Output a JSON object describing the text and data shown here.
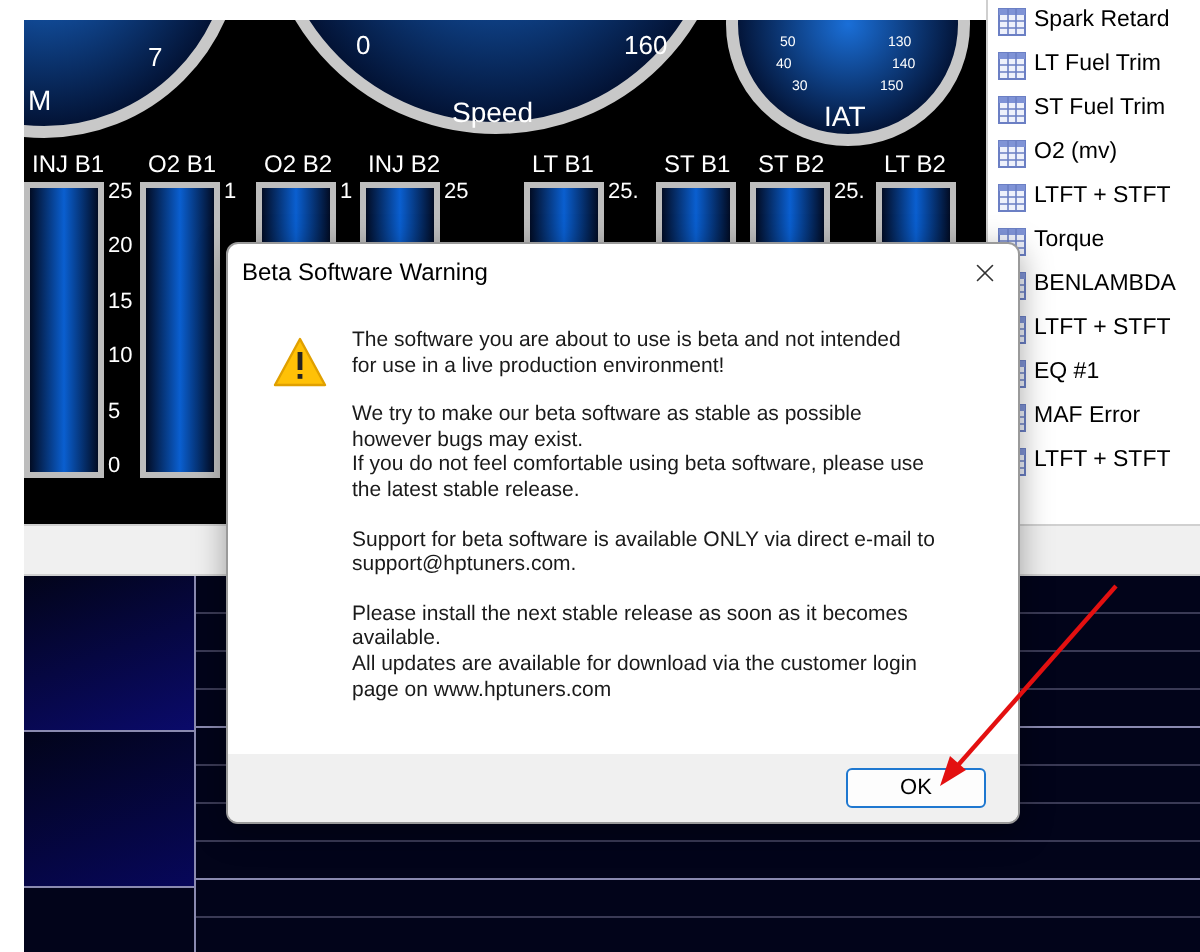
{
  "round_gauges": [
    {
      "label": "M",
      "ticks": [
        "7"
      ]
    },
    {
      "label": "Speed",
      "ticks": [
        "0",
        "160"
      ]
    },
    {
      "label": "IAT",
      "ticks": [
        "50",
        "40",
        "30",
        "130",
        "140",
        "150"
      ]
    }
  ],
  "bar_gauges": [
    {
      "label": "INJ B1",
      "scale": [
        "25",
        "20",
        "15",
        "10",
        "5",
        "0"
      ]
    },
    {
      "label": "O2 B1",
      "scale": [
        "1"
      ]
    },
    {
      "label": "O2 B2",
      "scale": [
        "1"
      ]
    },
    {
      "label": "INJ B2",
      "scale": [
        "25"
      ]
    },
    {
      "label": "LT B1",
      "scale": [
        "25."
      ]
    },
    {
      "label": "ST B1"
    },
    {
      "label": "ST B2",
      "scale": [
        "25."
      ]
    },
    {
      "label": "LT B2"
    }
  ],
  "sidebar": {
    "items": [
      "Spark Retard",
      "LT Fuel Trim",
      "ST Fuel Trim",
      "O2 (mv)",
      "LTFT + STFT",
      "Torque",
      "BENLAMBDA",
      "LTFT + STFT",
      "EQ #1",
      "MAF Error",
      "LTFT + STFT"
    ]
  },
  "dialog": {
    "title": "Beta Software Warning",
    "paragraphs": [
      "The software you are about to use is beta and not intended\nfor use in a live production environment!",
      "We try to make our beta software as stable as possible\nhowever bugs may exist.\nIf you do not feel comfortable using beta software, please use\nthe latest stable release.",
      "Support for beta software is available ONLY via direct e-mail to\nsupport@hptuners.com.",
      "Please install the next stable release as soon as it becomes\navailable.\nAll updates are available for download via the customer login\npage on www.hptuners.com"
    ],
    "buttons": [
      "OK"
    ]
  }
}
